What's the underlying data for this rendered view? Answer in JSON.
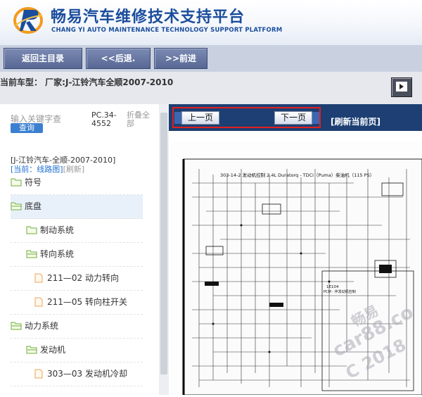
{
  "header": {
    "title": "畅易汽车维修技术支持平台",
    "subtitle": "CHANG YI AUTO MAINTENANCE TECHNOLOGY SUPPORT PLATFORM",
    "logo_icon": "cy-logo-icon"
  },
  "nav": {
    "back_main": "返回主目录",
    "prev": "<<后退.",
    "next": ">>前进"
  },
  "model": {
    "text": "当前车型：  厂家:J-江铃汽车全顺2007-2010"
  },
  "sidebar": {
    "search_placeholder": "输入关键字查",
    "search_button": "查询",
    "pc_code": "PC.34-4552",
    "collapse_all": "折叠全部",
    "root": "[J-江铃汽车-全顺-2007-2010]",
    "current": "[当前：线路图]",
    "refresh": "[刷新]",
    "items": [
      {
        "label": "符号",
        "type": "folder"
      },
      {
        "label": "底盘",
        "type": "folder",
        "selected": true
      },
      {
        "label": "制动系统",
        "type": "folder"
      },
      {
        "label": "转向系统",
        "type": "folder"
      },
      {
        "label": "211—02 动力转向",
        "type": "file"
      },
      {
        "label": "211—05 转向柱开关",
        "type": "file"
      },
      {
        "label": "动力系统",
        "type": "folder"
      },
      {
        "label": "发动机",
        "type": "folder"
      },
      {
        "label": "303—03 发动机冷却",
        "type": "file"
      }
    ]
  },
  "viewer": {
    "prev_page": "上一页",
    "next_page": "下一页",
    "refresh_page": "[刷新当前页]",
    "diagram_title": "303-14-2  发动机控制  2.4L Duratorq - TDCi（Puma）柴油机（115 PS）",
    "diagram_code1": "1E104",
    "diagram_code2": "PCM - 伴发动机控制",
    "watermark1": "畅易",
    "watermark2": "car88.co",
    "watermark3": "C  2018"
  },
  "colors": {
    "brand_blue": "#1a4d9c",
    "nav_button": "#6576a3",
    "toolbar": "#1d3f73",
    "highlight_red": "#e0201e",
    "link_blue": "#1f6fd1"
  }
}
